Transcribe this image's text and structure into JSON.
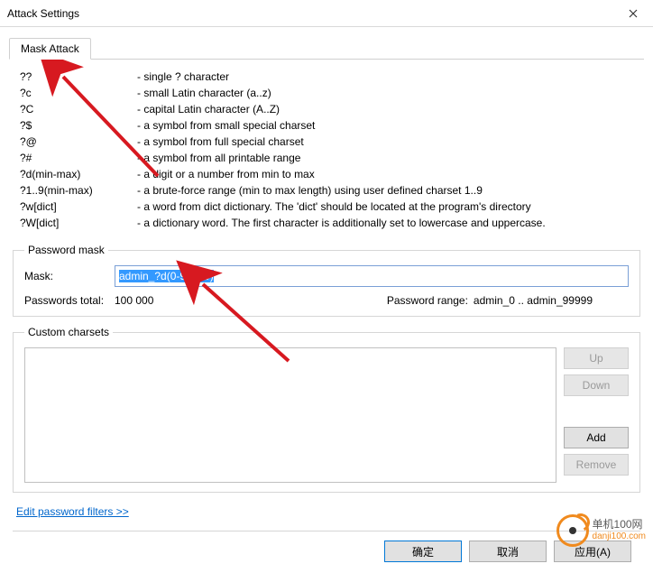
{
  "window": {
    "title": "Attack Settings"
  },
  "tab": {
    "label": "Mask Attack"
  },
  "help": [
    {
      "l": "??",
      "r": "- single ? character"
    },
    {
      "l": "?c",
      "r": "- small Latin character (a..z)"
    },
    {
      "l": "?C",
      "r": "- capital Latin character (A..Z)"
    },
    {
      "l": "?$",
      "r": "- a symbol from small special charset"
    },
    {
      "l": "?@",
      "r": "- a symbol from full special charset"
    },
    {
      "l": "?#",
      "r": "- a symbol from all printable range"
    },
    {
      "l": "?d(min-max)",
      "r": "- a digit or a number from min to max"
    },
    {
      "l": "?1..9(min-max)",
      "r": "- a brute-force range (min to max length) using user defined charset 1..9"
    },
    {
      "l": "?w[dict]",
      "r": "- a word from dict dictionary. The 'dict' should be located at the program's directory"
    },
    {
      "l": "?W[dict]",
      "r": "- a dictionary word. The first character is additionally set to lowercase and uppercase."
    }
  ],
  "password_mask": {
    "legend": "Password mask",
    "mask_label": "Mask:",
    "mask_value": "admin_?d(0-99999)",
    "total_label": "Passwords total:",
    "total_value": "100 000",
    "range_label": "Password range:",
    "range_value": "admin_0  ..  admin_99999"
  },
  "custom_charsets": {
    "legend": "Custom charsets",
    "buttons": {
      "up": "Up",
      "down": "Down",
      "add": "Add",
      "remove": "Remove"
    }
  },
  "filters_link": "Edit password filters >>",
  "dialog_buttons": {
    "ok": "确定",
    "cancel": "取消",
    "apply": "应用(A)"
  },
  "watermark": {
    "line1": "单机100网",
    "line2": "danji100.com"
  }
}
